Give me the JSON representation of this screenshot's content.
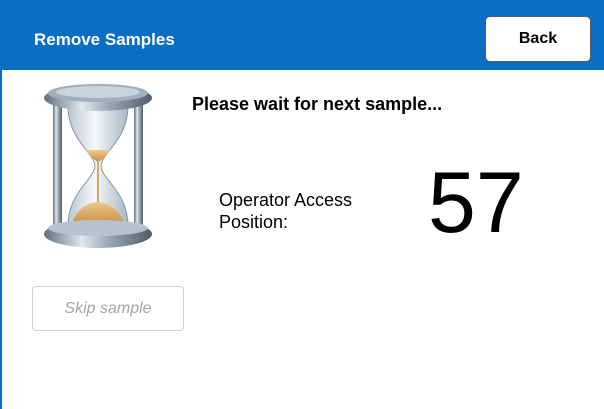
{
  "header": {
    "title": "Remove Samples",
    "back_label": "Back",
    "background_color": "#0a6fc2"
  },
  "status": {
    "icon": "hourglass-icon",
    "message": "Please wait for next sample...",
    "access_label": "Operator Access Position:",
    "access_position": "57"
  },
  "actions": {
    "skip_label": "Skip sample",
    "skip_enabled": false
  }
}
